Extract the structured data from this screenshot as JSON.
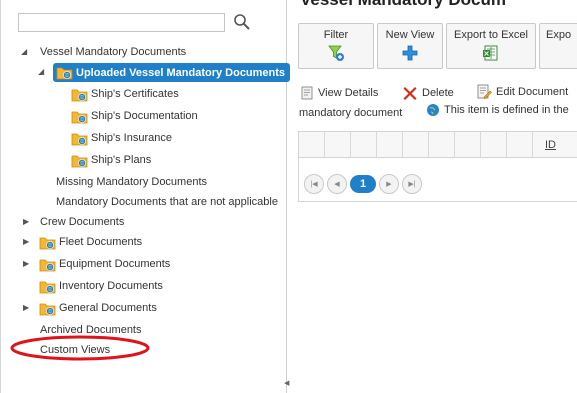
{
  "search": {
    "value": ""
  },
  "tree": {
    "vessel_mandatory": {
      "label": "Vessel Mandatory Documents"
    },
    "uploaded": {
      "label": "Uploaded Vessel Mandatory Documents"
    },
    "children": [
      {
        "label": "Ship's Certificates"
      },
      {
        "label": "Ship's Documentation"
      },
      {
        "label": "Ship's Insurance"
      },
      {
        "label": "Ship's Plans"
      }
    ],
    "missing": {
      "label": "Missing Mandatory Documents"
    },
    "not_applicable": {
      "label": "Mandatory Documents that are not applicable"
    },
    "crew": {
      "label": "Crew Documents"
    },
    "fleet": {
      "label": "Fleet Documents"
    },
    "equipment": {
      "label": "Equipment Documents"
    },
    "inventory": {
      "label": "Inventory Documents"
    },
    "general": {
      "label": "General Documents"
    },
    "archived": {
      "label": "Archived Documents"
    },
    "custom_views": {
      "label": "Custom Views"
    }
  },
  "main": {
    "title": "Vessel Mandatory Docum",
    "toolbar": {
      "filter": "Filter",
      "new_view": "New View",
      "export_excel": "Export to Excel",
      "export_partial": "Expo"
    },
    "actions": {
      "view_details": "View Details",
      "delete": "Delete",
      "edit_document": "Edit Document"
    },
    "info": {
      "left": "mandatory document",
      "right": "This item is defined in the"
    },
    "grid": {
      "id_header": "ID"
    },
    "pager": {
      "current": "1"
    }
  },
  "colors": {
    "accent": "#1f7fc8",
    "annotation": "#e0121b"
  }
}
